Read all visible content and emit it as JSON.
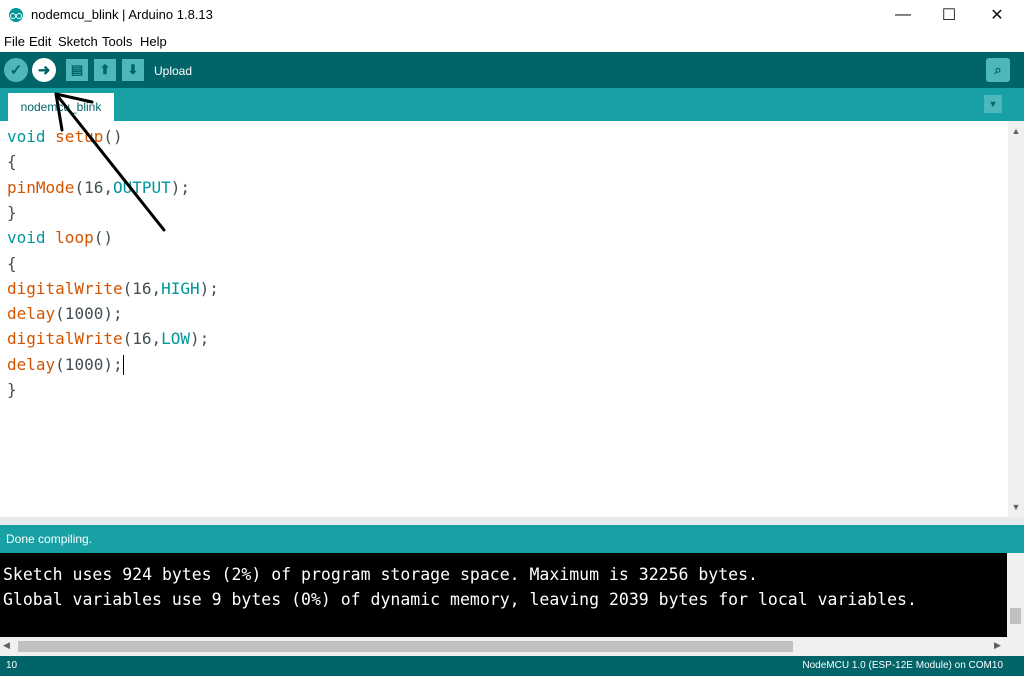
{
  "window": {
    "title": "nodemcu_blink | Arduino 1.8.13",
    "minimize_glyph": "—",
    "maximize_glyph": "☐",
    "close_glyph": "✕"
  },
  "menu": {
    "items": [
      "File",
      "Edit",
      "Sketch",
      "Tools",
      "Help"
    ]
  },
  "toolbar": {
    "hover_label": "Upload",
    "buttons": [
      {
        "name": "verify",
        "glyph": "✓"
      },
      {
        "name": "upload",
        "glyph": "➜"
      },
      {
        "name": "new",
        "glyph": "▤"
      },
      {
        "name": "open",
        "glyph": "⬆"
      },
      {
        "name": "save",
        "glyph": "⬇"
      }
    ],
    "serial_monitor_glyph": "⌕"
  },
  "tabs": {
    "active": "nodemcu_blink",
    "menu_glyph": "▼"
  },
  "editor": {
    "lines": [
      [
        {
          "t": "void",
          "c": "kw"
        },
        {
          "t": " "
        },
        {
          "t": "setup",
          "c": "fn"
        },
        {
          "t": "()"
        }
      ],
      [
        {
          "t": "{"
        }
      ],
      [
        {
          "t": "pinMode",
          "c": "fn"
        },
        {
          "t": "(16,"
        },
        {
          "t": "OUTPUT",
          "c": "const"
        },
        {
          "t": ");"
        }
      ],
      [
        {
          "t": "}"
        }
      ],
      [
        {
          "t": "void",
          "c": "kw"
        },
        {
          "t": " "
        },
        {
          "t": "loop",
          "c": "fn"
        },
        {
          "t": "()"
        }
      ],
      [
        {
          "t": "{"
        }
      ],
      [
        {
          "t": "digitalWrite",
          "c": "fn"
        },
        {
          "t": "(16,"
        },
        {
          "t": "HIGH",
          "c": "const"
        },
        {
          "t": ");"
        }
      ],
      [
        {
          "t": "delay",
          "c": "fn"
        },
        {
          "t": "(1000);"
        }
      ],
      [
        {
          "t": "digitalWrite",
          "c": "fn"
        },
        {
          "t": "(16,"
        },
        {
          "t": "LOW",
          "c": "const"
        },
        {
          "t": ");"
        }
      ],
      [
        {
          "t": "delay",
          "c": "fn"
        },
        {
          "t": "(1000);"
        }
      ],
      [
        {
          "t": "}"
        }
      ]
    ],
    "cursor_line_index": 9
  },
  "status": {
    "message": "Done compiling."
  },
  "console": {
    "lines": [
      "Sketch uses 924 bytes (2%) of program storage space. Maximum is 32256 bytes.",
      "Global variables use 9 bytes (0%) of dynamic memory, leaving 2039 bytes for local variables."
    ]
  },
  "footer": {
    "line_number": "10",
    "board": "NodeMCU 1.0 (ESP-12E Module) on COM10"
  },
  "colors": {
    "toolbar": "#006468",
    "tabbar": "#17a1a5",
    "keyword": "#00979c",
    "function": "#d35400"
  }
}
